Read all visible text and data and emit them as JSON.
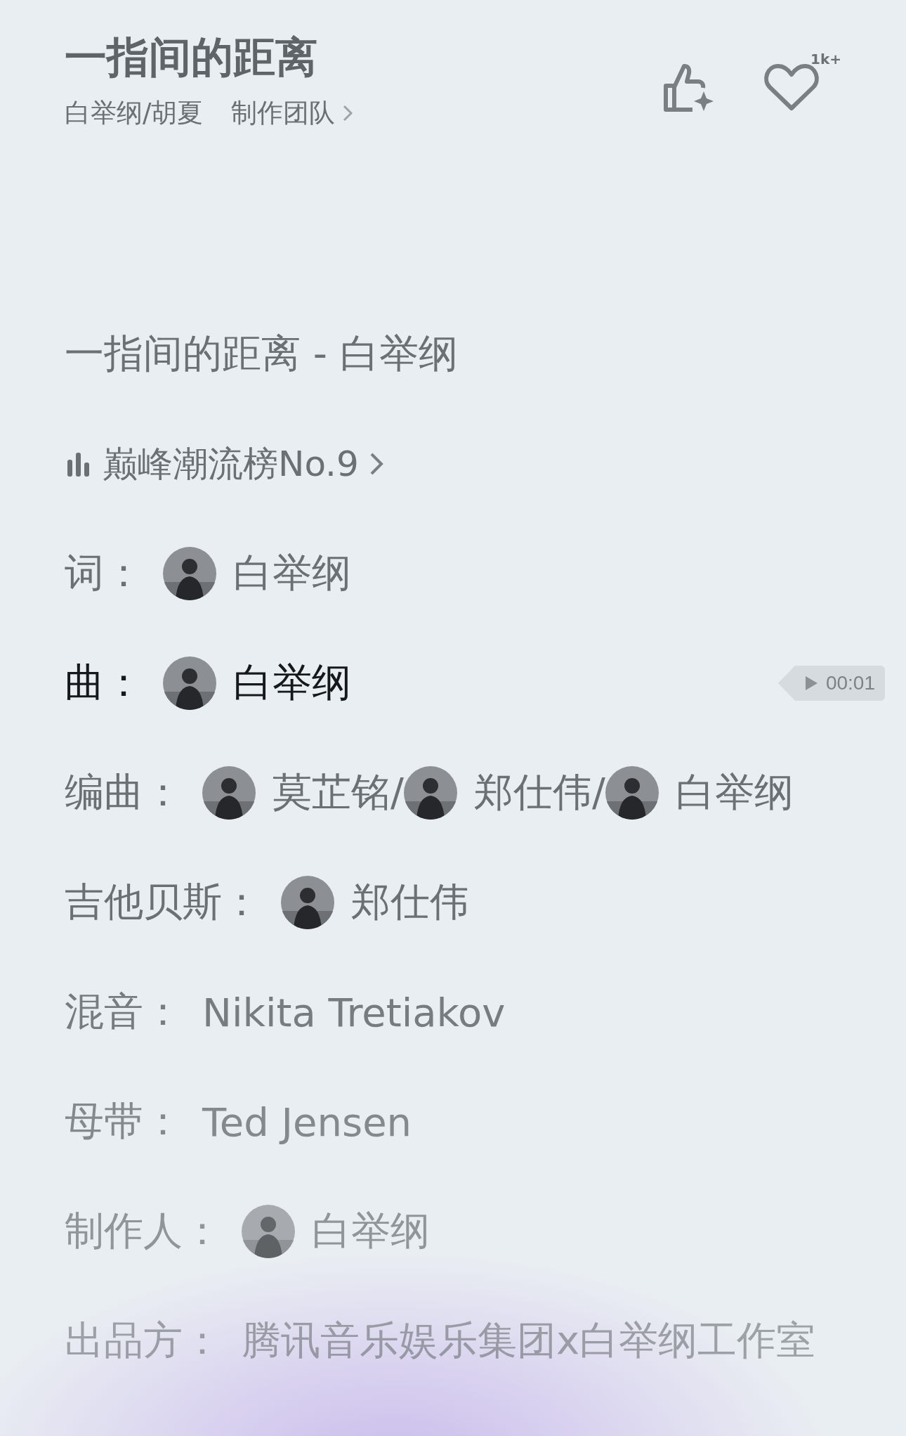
{
  "song": {
    "title": "一指间的距离",
    "artists": "白举纲/胡夏",
    "team_link": "制作团队",
    "like_count": "1k+"
  },
  "lines": [
    {
      "kind": "text",
      "current": false,
      "text": "一指间的距离 - 白举纲"
    },
    {
      "kind": "chart",
      "current": false,
      "text": "巅峰潮流榜No.9"
    },
    {
      "kind": "credit",
      "current": false,
      "label": "词：",
      "credits": [
        {
          "avatar": true,
          "name": "白举纲"
        }
      ]
    },
    {
      "kind": "credit",
      "current": true,
      "label": "曲：",
      "credits": [
        {
          "avatar": true,
          "name": "白举纲"
        }
      ],
      "preview": "00:01"
    },
    {
      "kind": "credit",
      "current": false,
      "label": "编曲：",
      "credits": [
        {
          "avatar": true,
          "name": "莫芷铭/"
        },
        {
          "avatar": true,
          "name": "郑仕伟/"
        },
        {
          "avatar": true,
          "name": "白举纲"
        }
      ]
    },
    {
      "kind": "credit",
      "current": false,
      "label": "吉他贝斯：",
      "credits": [
        {
          "avatar": true,
          "name": "郑仕伟"
        }
      ]
    },
    {
      "kind": "credit",
      "current": false,
      "label": "混音：",
      "credits": [
        {
          "avatar": false,
          "name": "Nikita Tretiakov"
        }
      ]
    },
    {
      "kind": "credit",
      "current": false,
      "label": "母带：",
      "credits": [
        {
          "avatar": false,
          "name": "Ted Jensen"
        }
      ]
    },
    {
      "kind": "credit",
      "current": false,
      "label": "制作人：",
      "credits": [
        {
          "avatar": true,
          "name": "白举纲"
        }
      ]
    },
    {
      "kind": "credit",
      "current": false,
      "label": "出品方：",
      "credits": [
        {
          "avatar": false,
          "name": "腾讯音乐娱乐集团x白举纲工作室"
        }
      ]
    }
  ]
}
